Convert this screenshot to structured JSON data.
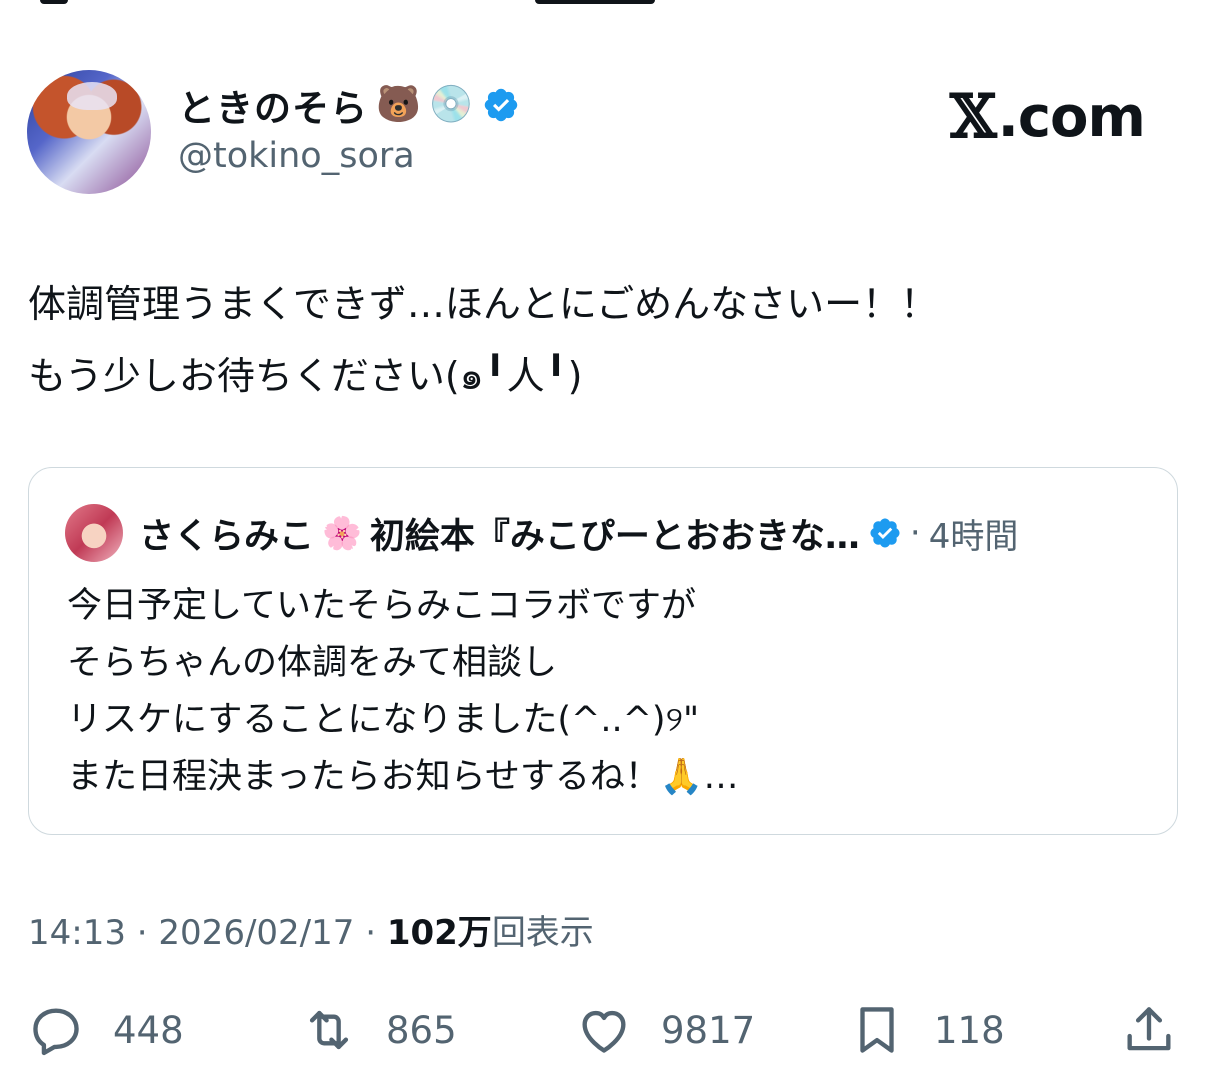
{
  "author": {
    "display_name": "ときのそら",
    "name_emojis": [
      "🐻",
      "💿"
    ],
    "handle": "@tokino_sora",
    "verified": true
  },
  "brand": {
    "logo_text": ".com",
    "logo_glyph": "𝕏"
  },
  "tweet": {
    "lines": [
      "体調管理うまくできず…ほんとにごめんなさいー！！",
      "もう少しお待ちください(๑╹人╹)"
    ]
  },
  "quoted": {
    "display_name": "さくらみこ",
    "name_emoji": "🌸",
    "name_suffix": "初絵本『みこぴーとおおきな…",
    "separator": "·",
    "time": "4時間",
    "lines": [
      "今日予定していたそらみこコラボですが",
      "そらちゃんの体調をみて相談し",
      "リスケにすることになりました(^..^)୨\"",
      "また日程決まったらお知らせするね！🙏…"
    ]
  },
  "meta": {
    "time": "14:13",
    "date": "2026/02/17",
    "separator": "·",
    "views_count": "102万",
    "views_label": "回表示"
  },
  "actions": {
    "replies": "448",
    "reposts": "865",
    "likes": "9817",
    "bookmarks": "118"
  },
  "colors": {
    "text": "#0f1419",
    "muted": "#536471",
    "verified": "#1d9bf0",
    "border": "#cfd9de"
  }
}
